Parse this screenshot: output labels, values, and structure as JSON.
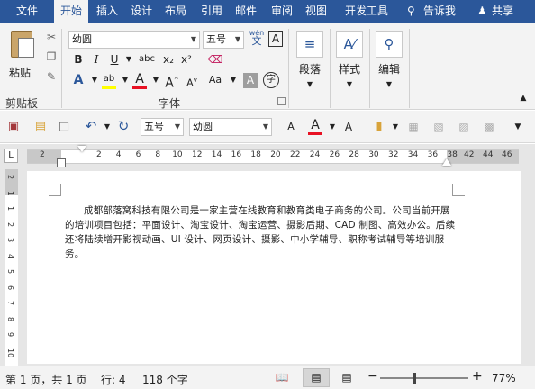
{
  "tabs": [
    "文件",
    "开始",
    "插入",
    "设计",
    "布局",
    "引用",
    "邮件",
    "审阅",
    "视图",
    "开发工具"
  ],
  "tab_right": {
    "lightbulb": "♀",
    "tell": "告诉我",
    "share": "共享"
  },
  "ribbon": {
    "clipboard": {
      "paste": "粘贴",
      "label": "剪贴板"
    },
    "font": {
      "name": "幼圆",
      "size": "五号",
      "label": "字体",
      "wen": "wén",
      "bold": "B",
      "italic": "I",
      "underline": "U",
      "strike": "abc",
      "sub": "x₂",
      "sup": "x²",
      "hl_letter": "ab",
      "color_letter": "A",
      "a_up": "A",
      "a_down": "A",
      "aa": "Aa",
      "shade": "A",
      "circle": "字"
    },
    "paragraph": {
      "label": "段落"
    },
    "styles": {
      "label": "样式"
    },
    "editing": {
      "label": "编辑"
    }
  },
  "qat": {
    "size": "五号",
    "font": "幼圆"
  },
  "ruler_left": [
    "2"
  ],
  "ruler_nums": [
    "2",
    "4",
    "6",
    "8",
    "10",
    "12",
    "14",
    "16",
    "18",
    "20",
    "22",
    "24",
    "26",
    "28",
    "30",
    "32",
    "34",
    "36",
    "38"
  ],
  "ruler_right": [
    "42",
    "44",
    "46"
  ],
  "vruler_nums": [
    "2",
    "1",
    "1",
    "2",
    "3",
    "4",
    "5",
    "6",
    "7",
    "8",
    "9",
    "10"
  ],
  "document": {
    "text": "成都部落窝科技有限公司是一家主营在线教育和教育类电子商务的公司。公司当前开展的培训项目包括：平面设计、淘宝设计、淘宝运营、摄影后期、CAD 制图、高效办公。后续还将陆续增开影视动画、UI 设计、网页设计、摄影、中小学辅导、职称考试辅导等培训服务。"
  },
  "status": {
    "page": "第 1 页，共 1 页",
    "line": "行: 4",
    "words": "118 个字",
    "zoom": "77%",
    "minus": "−",
    "plus": "+"
  },
  "colors": {
    "accent": "#2b579a",
    "font_red": "#e81123",
    "highlight": "#ffff00",
    "save": "#a4373a"
  }
}
